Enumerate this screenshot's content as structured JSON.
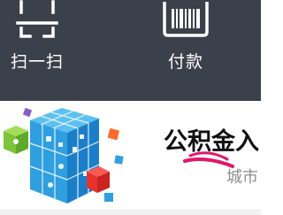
{
  "actions": {
    "scan": {
      "label": "扫一扫",
      "icon": "scan-frame-icon"
    },
    "pay": {
      "label": "付款",
      "icon": "barcode-icon"
    }
  },
  "banner": {
    "title": "公积金入",
    "subtitle": "城市",
    "illustration": "cube-services-illustration"
  },
  "colors": {
    "topbar_bg": "#3b414a",
    "cube_blue": "#2f9fe0",
    "accent_red": "#e8332c",
    "accent_green": "#7cc43a",
    "stroke_pink": "#e0176d"
  }
}
